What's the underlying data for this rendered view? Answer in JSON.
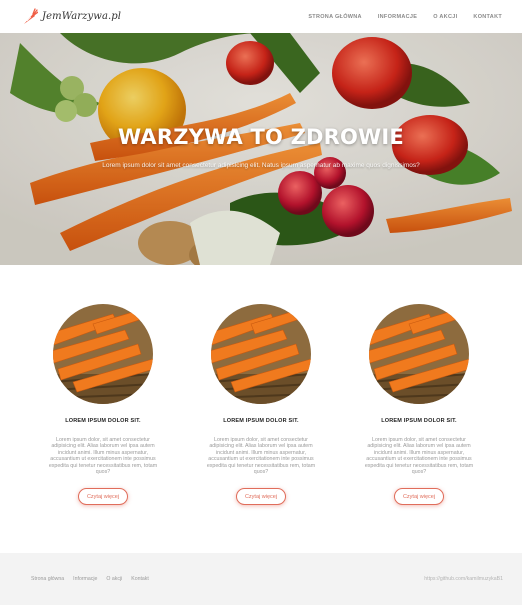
{
  "header": {
    "logo_text": "JemWarzywa.pl",
    "nav": [
      "STRONA GŁÓWNA",
      "INFORMACJE",
      "O AKCJI",
      "KONTAKT"
    ]
  },
  "hero": {
    "title": "WARZYWA TO ZDROWIE",
    "subtitle": "Lorem ipsum dolor sit amet consectetur adipisicing elit. Natus ipsum aspernatur ab maxime quos dignissimos?"
  },
  "cards": [
    {
      "title": "LOREM IPSUM DOLOR SIT.",
      "text": "Lorem ipsum dolor, sit amet consectetur adipisicing elit. Alias laborum vel ipsa autem incidunt animi. Illum minus aspernatur, accusantium ut exercitationem inte possimus expedita qui tenetur necessitatibus rem, totam quos?",
      "button": "Czytaj więcej"
    },
    {
      "title": "LOREM IPSUM DOLOR SIT.",
      "text": "Lorem ipsum dolor, sit amet consectetur adipisicing elit. Alias laborum vel ipsa autem incidunt animi. Illum minus aspernatur, accusantium ut exercitationem inte possimus expedita qui tenetur necessitatibus rem, totam quos?",
      "button": "Czytaj więcej"
    },
    {
      "title": "LOREM IPSUM DOLOR SIT.",
      "text": "Lorem ipsum dolor, sit amet consectetur adipisicing elit. Alias laborum vel ipsa autem incidunt animi. Illum minus aspernatur, accusantium ut exercitationem inte possimus expedita qui tenetur necessitatibus rem, totam quos?",
      "button": "Czytaj więcej"
    }
  ],
  "footer": {
    "links": [
      "Strona główna",
      "Informacje",
      "O akcji",
      "Kontakt"
    ],
    "url": "https://github.com/kamilmuzykaB1"
  },
  "colors": {
    "accent": "#e06d5b",
    "footer_bg": "#f3f3f3"
  },
  "icons": {
    "logo": "carrot-icon"
  }
}
